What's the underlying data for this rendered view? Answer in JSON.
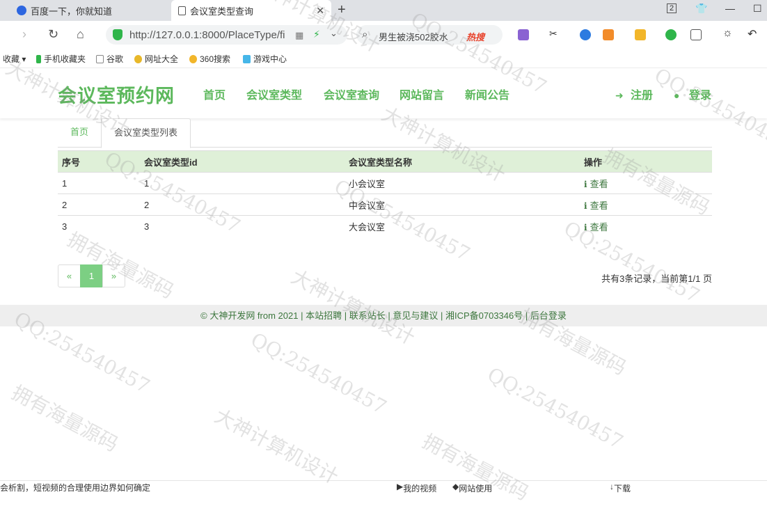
{
  "browser": {
    "tabs": [
      {
        "title": "百度一下，你就知道"
      },
      {
        "title": "会议室类型查询"
      }
    ],
    "tab_count": "2",
    "address": "http://127.0.0.1:8000/PlaceType/fi",
    "search_query": "男生被浇502胶水",
    "search_hot": "热搜",
    "bookmarks": [
      "收藏",
      "手机收藏夹",
      "谷歌",
      "网址大全",
      "360搜索",
      "游戏中心"
    ],
    "statusbar_left": "会析割，短视频的合理使用边界如何确定",
    "statusbar_items": [
      "我的视频",
      "网站使用",
      "下载"
    ],
    "colors": {
      "accent": "#5cb85c",
      "table_header": "#dff0d8",
      "active_page": "#7ccf83"
    }
  },
  "site": {
    "brand": "会议室预约网",
    "nav": [
      "首页",
      "会议室类型",
      "会议室查询",
      "网站留言",
      "新闻公告"
    ],
    "register": "注册",
    "login": "登录"
  },
  "tabs": {
    "home": "首页",
    "current": "会议室类型列表"
  },
  "table": {
    "headers": [
      "序号",
      "会议室类型id",
      "会议室类型名称",
      "操作"
    ],
    "rows": [
      {
        "no": "1",
        "id": "1",
        "name": "小会议室",
        "action": "查看"
      },
      {
        "no": "2",
        "id": "2",
        "name": "中会议室",
        "action": "查看"
      },
      {
        "no": "3",
        "id": "3",
        "name": "大会议室",
        "action": "查看"
      }
    ]
  },
  "pagination": {
    "prev": "«",
    "current": "1",
    "next": "»",
    "info": "共有3条记录，当前第1/1 页"
  },
  "footer": {
    "copyright": "© 大神开发网 from 2021",
    "links": [
      "本站招聘",
      "联系站长",
      "意见与建议",
      "湘ICP备0703346号",
      "后台登录"
    ]
  },
  "watermarks": [
    "大神计算机设计",
    "QQ:254540457",
    "拥有海量源码"
  ]
}
